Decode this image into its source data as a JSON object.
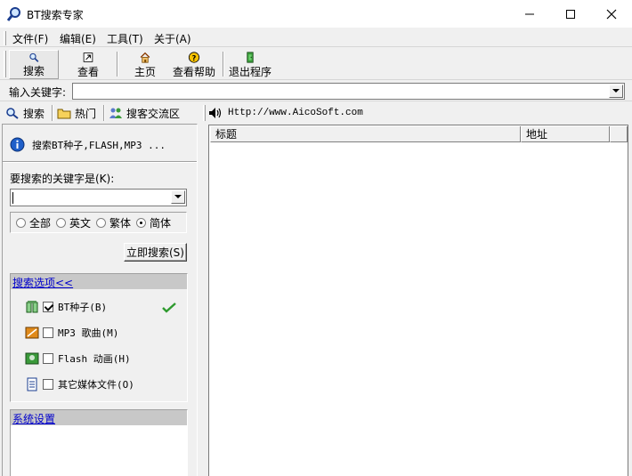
{
  "window": {
    "title": "BT搜索专家",
    "icon": "magnifier-icon"
  },
  "menu": {
    "items": [
      {
        "label": "文件(F)"
      },
      {
        "label": "编辑(E)"
      },
      {
        "label": "工具(T)"
      },
      {
        "label": "关于(A)"
      }
    ]
  },
  "toolbar": {
    "buttons": [
      {
        "label": "搜索",
        "icon": "search-icon",
        "pressed": true
      },
      {
        "label": "查看",
        "icon": "view-icon"
      },
      {
        "label": "主页",
        "icon": "home-icon"
      },
      {
        "label": "查看帮助",
        "icon": "help-icon"
      },
      {
        "label": "退出程序",
        "icon": "exit-icon"
      }
    ]
  },
  "keyword_bar": {
    "label": "输入关键字:",
    "value": ""
  },
  "left_tabs": [
    {
      "label": "搜索",
      "icon": "search-icon"
    },
    {
      "label": "热门",
      "icon": "folder-icon"
    },
    {
      "label": "搜客交流区",
      "icon": "users-icon"
    }
  ],
  "search_panel": {
    "info_text": "搜索BT种子,FLASH,MP3 ...",
    "prompt": "要搜索的关键字是(K):",
    "keyword_value": "",
    "languages": [
      {
        "label": "全部",
        "selected": false
      },
      {
        "label": "英文",
        "selected": false
      },
      {
        "label": "繁体",
        "selected": false
      },
      {
        "label": "简体",
        "selected": true
      }
    ],
    "search_button": "立即搜索(S)"
  },
  "options": {
    "header": "搜索选项<<",
    "items": [
      {
        "label": "BT种子(B)",
        "checked": true,
        "icon": "bt-seed-icon"
      },
      {
        "label": "MP3 歌曲(M)",
        "checked": false,
        "icon": "music-icon"
      },
      {
        "label": "Flash 动画(H)",
        "checked": false,
        "icon": "flash-icon"
      },
      {
        "label": "其它媒体文件(O)",
        "checked": false,
        "icon": "document-icon"
      }
    ]
  },
  "system_settings": {
    "header": "系统设置"
  },
  "right_panel": {
    "url": "Http://www.AicoSoft.com",
    "columns": [
      {
        "label": "标题"
      },
      {
        "label": "地址"
      },
      {
        "label": ""
      }
    ]
  },
  "colors": {
    "link": "#0000cc",
    "accent_green": "#2e9a2e"
  }
}
